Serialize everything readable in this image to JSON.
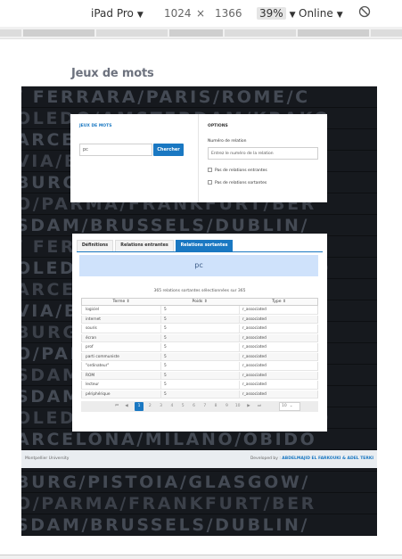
{
  "devtools": {
    "device": "iPad Pro",
    "width": "1024",
    "times": "×",
    "height": "1366",
    "zoom": "39%",
    "network": "Online",
    "rotate_icon": "rotate-icon"
  },
  "site": {
    "title": "Jeux de mots"
  },
  "board_rows": [
    "/ FERRARA/PARIS/ROME/C",
    "OLEDO/AMSTERDAM/KRAKO",
    "ARCELONA/MILANO/OBIDO",
    "VIA/BUDAPEST/NAPOLI/LI",
    "BURG/PISTOIA/GLASGOW/",
    "O/PARMA/FRANKFURT/BER",
    "SDAM/BRUSSELS/DUBLIN/",
    "/ FERRARA/PARIS/ROME/C",
    "OLEDO/AMSTERDAM/KRAKO",
    "ARCELONA/MILANO/OBIDO",
    "VIA/BUDAPEST/NAPOLI/LI",
    "BURG/PISTOIA/GLASGOW/",
    "O/PARMA/FRANKFURT/BER",
    "SDAM/BRUSSELS/DUBLIN/",
    "SDAM/BRUSSELS/DUBLIN/",
    "OLEDO/AMSTERDAM/KRAKO",
    "ARCELONA/MILANO/OBIDO",
    "VIA/BUDAPEST/NAPOLI/LI",
    "BURG/PISTOIA/GLASGOW/",
    "O/PARMA/FRANKFURT/BER",
    "SDAM/BRUSSELS/DUBLIN/"
  ],
  "search_panel": {
    "heading": "JEUX DE MOTS",
    "input_value": "pc",
    "button_label": "Chercher"
  },
  "options_panel": {
    "heading": "OPTIONS",
    "relation_label": "Numéro de relation",
    "relation_placeholder": "Entrez le numéro de la relation",
    "check_incoming": "Pas de relations entrantes",
    "check_outgoing": "Pas de relations sortantes"
  },
  "results": {
    "tabs": [
      "Définitions",
      "Relations entrantes",
      "Relations sortantes"
    ],
    "active_tab": 2,
    "term": "pc",
    "count_text": "365 relations sortantes sélectionnées sur 365",
    "columns": [
      "Terme ⇕",
      "Poids ⇕",
      "Type ⇕"
    ],
    "rows": [
      [
        "logiciel",
        "5",
        "r_associated"
      ],
      [
        "internet",
        "5",
        "r_associated"
      ],
      [
        "souris",
        "5",
        "r_associated"
      ],
      [
        "écran",
        "5",
        "r_associated"
      ],
      [
        "prof",
        "5",
        "r_associated"
      ],
      [
        "parti communiste",
        "5",
        "r_associated"
      ],
      [
        "\"ordinateur\"",
        "5",
        "r_associated"
      ],
      [
        "ROM",
        "5",
        "r_associated"
      ],
      [
        "lecteur",
        "5",
        "r_associated"
      ],
      [
        "périphérique",
        "5",
        "r_associated"
      ]
    ],
    "pager": {
      "first": "⏮",
      "prev": "◀",
      "pages": [
        "1",
        "2",
        "3",
        "4",
        "5",
        "6",
        "7",
        "8",
        "9",
        "10"
      ],
      "active_page": 0,
      "next": "▶",
      "last": "⏭",
      "page_size": "10"
    }
  },
  "footer": {
    "left": "Montpellier University",
    "right_prefix": "Developed by : ",
    "right_names": "ABDELMAJID EL FARKOUKI & ADEL TERKI"
  }
}
